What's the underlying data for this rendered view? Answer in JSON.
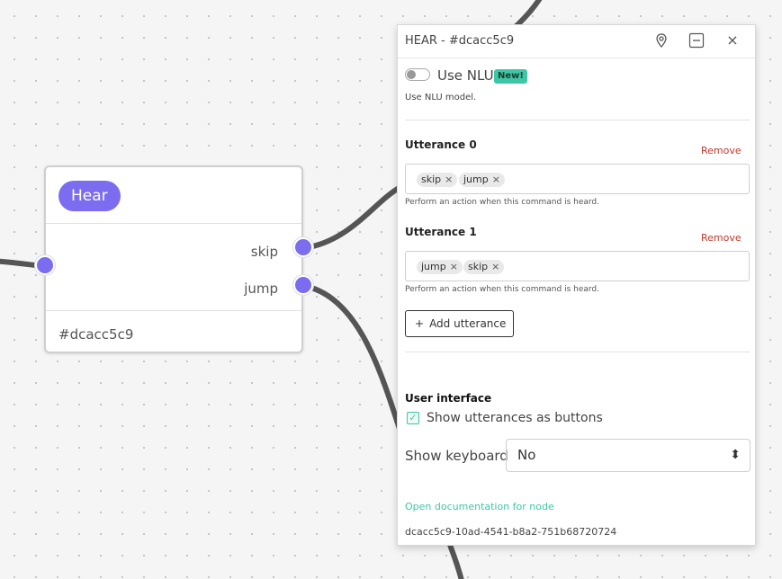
{
  "node": {
    "badge": "Hear",
    "outputs": [
      "skip",
      "jump"
    ],
    "id_label": "#dcacc5c9"
  },
  "panel": {
    "title": "HEAR - #dcacc5c9",
    "nlu": {
      "label": "Use NLU",
      "badge": "New!",
      "description": "Use NLU model.",
      "enabled": false
    },
    "utterances": [
      {
        "label": "Utterance 0",
        "remove": "Remove",
        "tags": [
          "skip",
          "jump"
        ],
        "hint": "Perform an action when this command is heard."
      },
      {
        "label": "Utterance 1",
        "remove": "Remove",
        "tags": [
          "jump",
          "skip"
        ],
        "hint": "Perform an action when this command is heard."
      }
    ],
    "add_utterance": "Add utterance",
    "add_icon": "+",
    "ui_section": {
      "title": "User interface",
      "show_buttons_label": "Show utterances as buttons",
      "show_buttons_checked": true,
      "keyboard_label": "Show keyboard",
      "keyboard_value": "No"
    },
    "doc_link": "Open documentation for node",
    "node_uuid": "dcacc5c9-10ad-4541-b8a2-751b68720724"
  },
  "colors": {
    "accent": "#7b6cf0",
    "brand": "#3ec7a4",
    "danger": "#c0392b",
    "wire": "#555555"
  },
  "icons": {
    "tag_remove": "×",
    "close": "×",
    "checkmark": "✓",
    "select_arrows": "⬍"
  }
}
